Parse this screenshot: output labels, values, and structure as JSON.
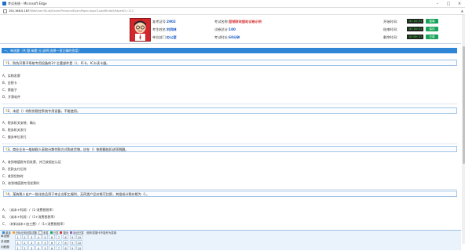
{
  "window": {
    "title": "考试系统 - Microsoft Edge",
    "url_host": "192.168.0.187",
    "url_path": "/WebUser/StudyExam/PersonalExamPaper.aspx?LoadWhite&PaperID=112"
  },
  "header": {
    "ticket_label": "准考证号:",
    "ticket_value": "2902",
    "exam_name_label": "考试名称:",
    "exam_name_value": "营销财政援助试卷示例",
    "name_label": "考生姓名:",
    "name_value": "刘同林",
    "total_score_label": "试卷总分:",
    "total_score_value": "100",
    "dept_label": "单位部门:",
    "dept_value": "办公室",
    "duration_label": "考试时长:",
    "duration_value": "60分钟",
    "start_time_label": "开始时间:",
    "start_time_value": "16:10:31",
    "end_time_label": "结束时间:",
    "end_time_value": "16:10:51",
    "remaining_label": "剩余时间:",
    "remaining_value": "16:00:31",
    "btn_score": "暂离",
    "btn_save": "保存",
    "btn_submit": "交卷"
  },
  "section": {
    "title": "一、单选题（共 题,每题 分,说明:选择一项正确的答案）"
  },
  "questions": [
    {
      "prompt": "1、防伪开票子系统专用设备的3个主要部件是（）、IC卡、IC卡读卡器。",
      "options": [
        "A、实物发票",
        "B、金税卡",
        "C、票据子",
        "D、开票软件"
      ]
    },
    {
      "prompt": "2、未经（）的防伪税控系统专用设备，不能使用。",
      "options": [
        "A、税务机关安装、确认",
        "B、税务机关发行",
        "C、服务单位发行"
      ]
    },
    {
      "prompt": "3、商业企业一般纳税人采取分期付款方式购进货物，应在（）依税额抵扣进项税额。",
      "options": [
        "A、收到增值税专用发票、并已按规定认证",
        "B、货款支付后时",
        "C、收到货物时",
        "D、收到增值税专用发票时"
      ]
    },
    {
      "prompt": "4、某纳税人自产一批化妆品用于本企业职工福利，无同类产品价格可比照，其组成计税价格为（）。",
      "options": [
        "A、（成本+利润）/（1-消费税税率）",
        "B、（成本+利润）/（1+消费税税率）",
        "C、（材料成本+加工费）/（1+消费税税率）"
      ]
    }
  ],
  "legend": {
    "items": [
      "单选",
      "已标记未回答试题",
      "未答",
      "已答",
      "疑问",
      "标记已答",
      "说明:答题卡不能作为答卷"
    ]
  },
  "answer_sheet": [
    {
      "label": "单选题",
      "cells": [
        "1",
        "2",
        "3",
        "4",
        "5",
        "6",
        "7",
        "8",
        "9",
        "10"
      ]
    },
    {
      "label": "多选题",
      "cells": [
        "1",
        "2",
        "3",
        "4",
        "5",
        "6",
        "7",
        "8",
        "9",
        "10"
      ]
    },
    {
      "label": "判断题",
      "cells": [
        "1",
        "2",
        "3",
        "4",
        "5",
        "6",
        "7",
        "8",
        "9",
        "10"
      ]
    }
  ]
}
